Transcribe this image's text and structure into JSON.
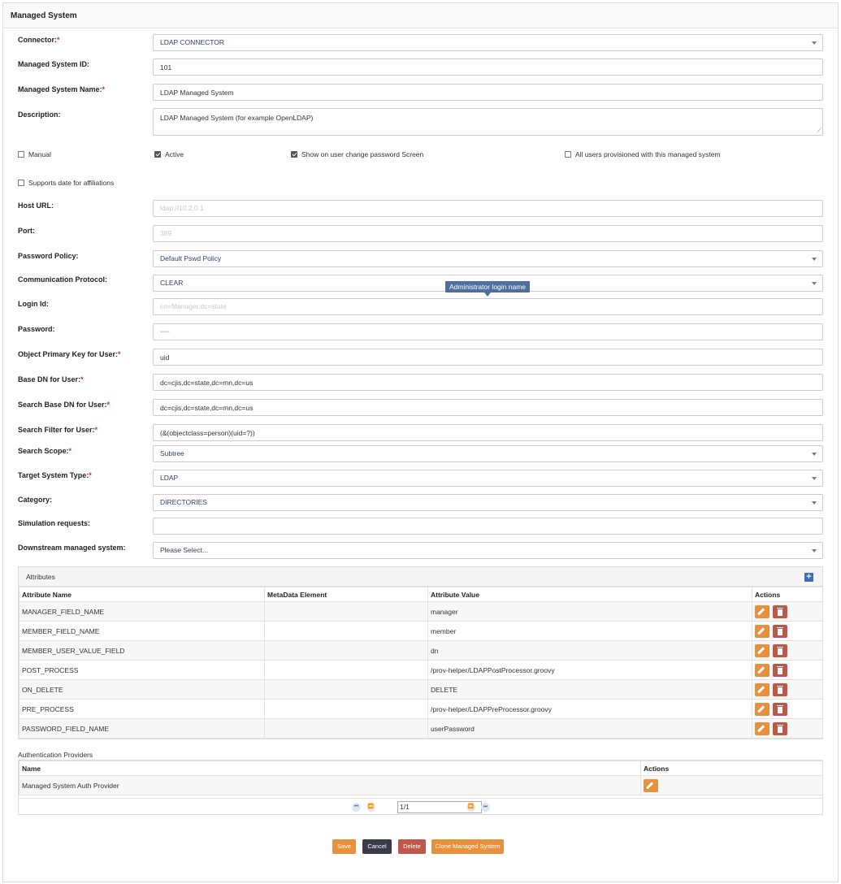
{
  "panel": {
    "title": "Managed System"
  },
  "form": {
    "connector": {
      "label": "Connector:",
      "value": "LDAP CONNECTOR"
    },
    "ms_id": {
      "label": "Managed System ID:",
      "value": "101"
    },
    "ms_name": {
      "label": "Managed System Name:",
      "value": "LDAP Managed System"
    },
    "description": {
      "label": "Description:",
      "value": "LDAP Managed System (for example OpenLDAP)"
    },
    "checkboxes": {
      "manual": {
        "label": "Manual",
        "checked": false
      },
      "active": {
        "label": "Active",
        "checked": true
      },
      "show_pwd": {
        "label": "Show on user change password Screen",
        "checked": true
      },
      "all_users": {
        "label": "All users provisioned with this managed system",
        "checked": false
      },
      "supports_date": {
        "label": "Supports date for affiliations",
        "checked": false
      }
    },
    "host_url": {
      "label": "Host URL:",
      "value": "ldap://10.2.0.1"
    },
    "port": {
      "label": "Port:",
      "value": "389"
    },
    "password_policy": {
      "label": "Password Policy:",
      "value": "Default Pswd Policy"
    },
    "comm_protocol": {
      "label": "Communication Protocol:",
      "value": "CLEAR"
    },
    "tooltip": "Administrator login name",
    "login_id": {
      "label": "Login Id:",
      "value": "cn=Manager,dc=state"
    },
    "password": {
      "label": "Password:",
      "value": "••••"
    },
    "obj_pk": {
      "label": "Object Primary Key for User:",
      "value": "uid"
    },
    "base_dn": {
      "label": "Base DN for User:",
      "value": "dc=cjis,dc=state,dc=mn,dc=us"
    },
    "search_base_dn": {
      "label": "Search Base DN for User:",
      "value": "dc=cjis,dc=state,dc=mn,dc=us"
    },
    "search_filter": {
      "label": "Search Filter for User:",
      "value": "(&(objectclass=person)(uid=?))"
    },
    "search_scope": {
      "label": "Search Scope:",
      "value": "Subtree"
    },
    "target_type": {
      "label": "Target System Type:",
      "value": "LDAP"
    },
    "category": {
      "label": "Category:",
      "value": "DIRECTORIES"
    },
    "simulation": {
      "label": "Simulation requests:",
      "value": ""
    },
    "downstream": {
      "label": "Downstream managed system:",
      "value": "Please Select..."
    }
  },
  "attributes": {
    "title": "Attributes",
    "columns": [
      "Attribute Name",
      "MetaData Element",
      "Attribute Value",
      "Actions"
    ],
    "rows": [
      {
        "name": "MANAGER_FIELD_NAME",
        "meta": "",
        "value": "manager"
      },
      {
        "name": "MEMBER_FIELD_NAME",
        "meta": "",
        "value": "member"
      },
      {
        "name": "MEMBER_USER_VALUE_FIELD",
        "meta": "",
        "value": "dn"
      },
      {
        "name": "POST_PROCESS",
        "meta": "",
        "value": "/prov-helper/LDAPPostProcessor.groovy"
      },
      {
        "name": "ON_DELETE",
        "meta": "",
        "value": "DELETE"
      },
      {
        "name": "PRE_PROCESS",
        "meta": "",
        "value": "/prov-helper/LDAPPreProcessor.groovy"
      },
      {
        "name": "PASSWORD_FIELD_NAME",
        "meta": "",
        "value": "userPassword"
      }
    ]
  },
  "auth": {
    "title": "Authentication Providers",
    "columns": [
      "Name",
      "Actions"
    ],
    "rows": [
      {
        "name": "Managed System Auth Provider"
      }
    ],
    "pager_value": "1/1"
  },
  "buttons": {
    "save": "Save",
    "cancel": "Cancel",
    "delete": "Delete",
    "clone": "Clone Managed System"
  }
}
